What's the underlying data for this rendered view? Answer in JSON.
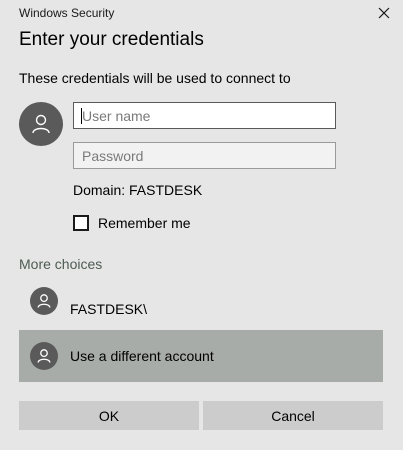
{
  "window": {
    "title": "Windows Security",
    "close_icon": "close-icon"
  },
  "dialog": {
    "heading": "Enter your credentials",
    "subtitle": "These credentials will be used to connect to",
    "avatar_icon": "user-icon"
  },
  "form": {
    "username": {
      "value": "",
      "placeholder": "User name"
    },
    "password": {
      "value": "",
      "placeholder": "Password"
    },
    "domain": "Domain: FASTDESK",
    "remember_me": {
      "label": "Remember me",
      "checked": false
    }
  },
  "more_choices": {
    "label": "More choices",
    "accounts": [
      {
        "label": "FASTDESK\\",
        "selected": false
      },
      {
        "label": "Use a different account",
        "selected": true
      }
    ]
  },
  "buttons": {
    "ok": "OK",
    "cancel": "Cancel"
  },
  "colors": {
    "background": "#e6e6e6",
    "selected_row": "#a8aca8",
    "avatar": "#5a5a5a",
    "button": "#cccccc"
  }
}
